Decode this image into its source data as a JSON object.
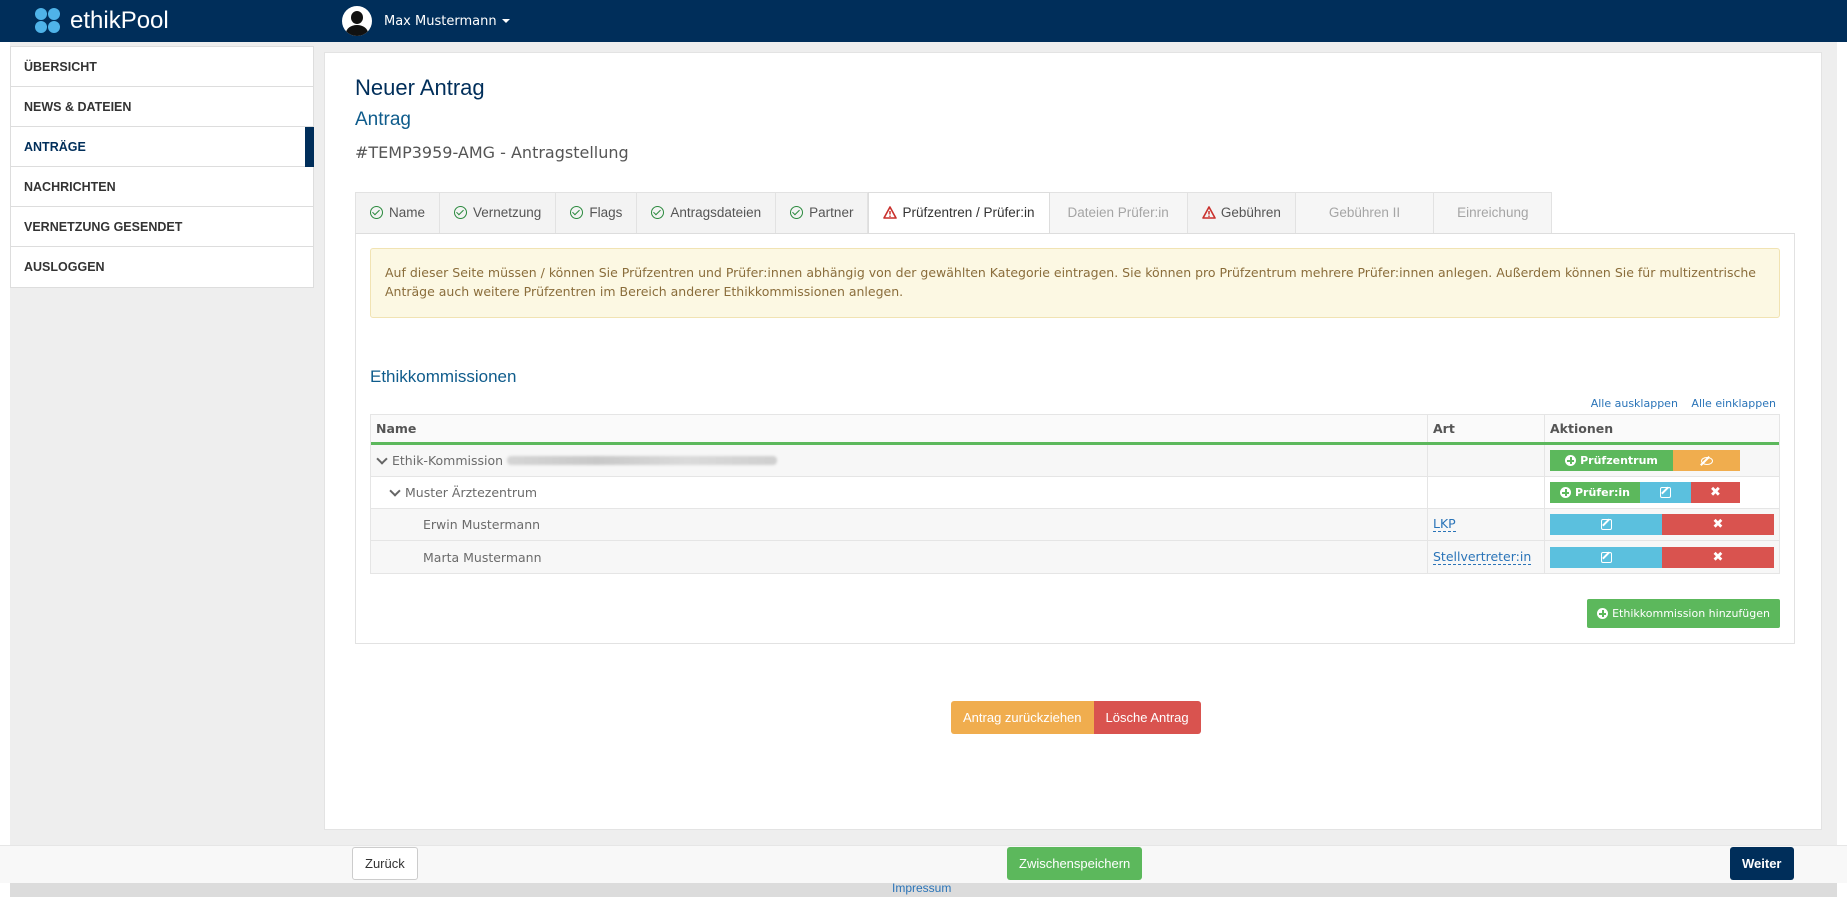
{
  "app": {
    "name": "ethikPool"
  },
  "user": {
    "name": "Max Mustermann"
  },
  "sidebar": {
    "items": [
      {
        "label": "ÜBERSICHT"
      },
      {
        "label": "NEWS & DATEIEN"
      },
      {
        "label": "ANTRÄGE"
      },
      {
        "label": "NACHRICHTEN"
      },
      {
        "label": "VERNETZUNG GESENDET"
      },
      {
        "label": "AUSLOGGEN"
      }
    ]
  },
  "page": {
    "title": "Neuer Antrag",
    "subtitle": "Antrag",
    "reference": "#TEMP3959-AMG - Antragstellung"
  },
  "tabs": [
    {
      "label": "Name",
      "status": "ok"
    },
    {
      "label": "Vernetzung",
      "status": "ok"
    },
    {
      "label": "Flags",
      "status": "ok"
    },
    {
      "label": "Antragsdateien",
      "status": "ok"
    },
    {
      "label": "Partner",
      "status": "ok"
    },
    {
      "label": "Prüfzentren / Prüfer:in",
      "status": "warning"
    },
    {
      "label": "Dateien Prüfer:in",
      "status": "disabled"
    },
    {
      "label": "Gebühren",
      "status": "warning"
    },
    {
      "label": "Gebühren II",
      "status": "disabled"
    },
    {
      "label": "Einreichung",
      "status": "disabled"
    }
  ],
  "alert": {
    "text": "Auf dieser Seite müssen / können Sie Prüfzentren und Prüfer:innen abhängig von der gewählten Kategorie eintragen. Sie können pro Prüfzentrum mehrere Prüfer:innen anlegen. Außerdem können Sie für multizentrische Anträge auch weitere Prüfzentren im Bereich anderer Ethikkommissionen anlegen."
  },
  "section": {
    "title": "Ethikkommissionen",
    "expand_all": "Alle ausklappen",
    "collapse_all": "Alle einklappen"
  },
  "table": {
    "headers": {
      "name": "Name",
      "art": "Art",
      "aktionen": "Aktionen"
    },
    "rows": [
      {
        "name": "Ethik-Kommission",
        "art": ""
      },
      {
        "name": "Muster Ärztezentrum",
        "art": ""
      },
      {
        "name": "Erwin Mustermann",
        "art": "LKP"
      },
      {
        "name": "Marta Mustermann",
        "art": "Stellvertreter:in"
      }
    ],
    "buttons": {
      "pruefzentrum": "Prüfzentrum",
      "pruefer": "Prüfer:in"
    }
  },
  "buttons": {
    "add_commission": "Ethikkommission hinzufügen",
    "withdraw": "Antrag zurückziehen",
    "delete": "Lösche Antrag"
  },
  "footer": {
    "back": "Zurück",
    "save": "Zwischenspeichern",
    "next": "Weiter",
    "impressum": "Impressum"
  },
  "colors": {
    "brand": "#002e5a",
    "success": "#5cb85c",
    "warning": "#f0ad4e",
    "info": "#5bc0de",
    "danger": "#d9534f",
    "link": "#2a74b8"
  }
}
